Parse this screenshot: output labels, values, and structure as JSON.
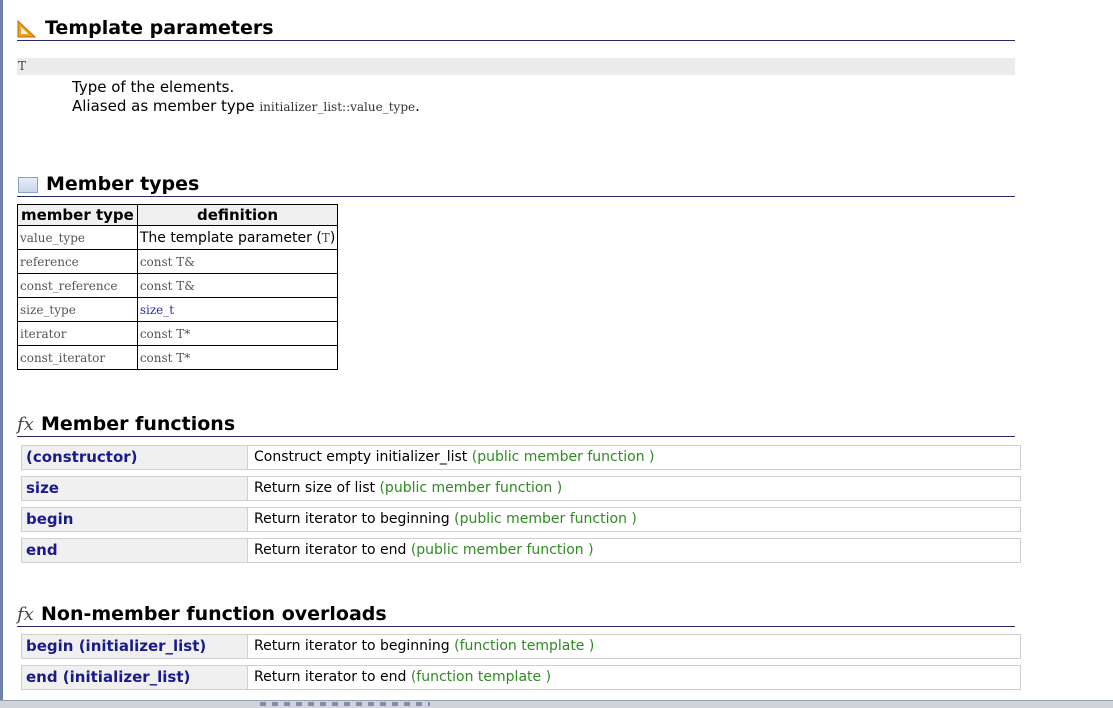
{
  "template_parameters": {
    "title": "Template parameters",
    "param_name": "T",
    "description_line1": "Type of the elements.",
    "description_line2_prefix": "Aliased as member type",
    "description_line2_code": "initializer_list::value_type",
    "description_line2_suffix": "."
  },
  "member_types": {
    "title": "Member types",
    "headers": [
      "member type",
      "definition"
    ],
    "rows": [
      {
        "type": "value_type",
        "definition_text": "The template parameter (",
        "definition_code": "T",
        "definition_end": ")"
      },
      {
        "type": "reference",
        "definition": "const T&"
      },
      {
        "type": "const_reference",
        "definition": "const T&"
      },
      {
        "type": "size_type",
        "definition": "size_t"
      },
      {
        "type": "iterator",
        "definition": "const T*"
      },
      {
        "type": "const_iterator",
        "definition": "const T*"
      }
    ]
  },
  "member_functions": {
    "title": "Member functions",
    "items": [
      {
        "name": "(constructor)",
        "desc": "Construct empty initializer_list",
        "kind": "(public member function )"
      },
      {
        "name": "size",
        "desc": "Return size of list",
        "kind": "(public member function )"
      },
      {
        "name": "begin",
        "desc": "Return iterator to beginning",
        "kind": "(public member function )"
      },
      {
        "name": "end",
        "desc": "Return iterator to end",
        "kind": "(public member function )"
      }
    ]
  },
  "non_member_overloads": {
    "title": "Non-member function overloads",
    "items": [
      {
        "name": "begin (initializer_list)",
        "desc": "Return iterator to beginning",
        "kind": "(function template )"
      },
      {
        "name": "end (initializer_list)",
        "desc": "Return iterator to end",
        "kind": "(function template )"
      }
    ]
  },
  "colors": {
    "heading_rule": "#29296b",
    "link_blue": "#1a1a8c",
    "note_green": "#2e8b22",
    "icon_orange": "#f0a020"
  },
  "icons": {
    "template_parameters": "triangle-ruler-icon",
    "member_types": "box-icon",
    "functions": "fx-icon"
  }
}
